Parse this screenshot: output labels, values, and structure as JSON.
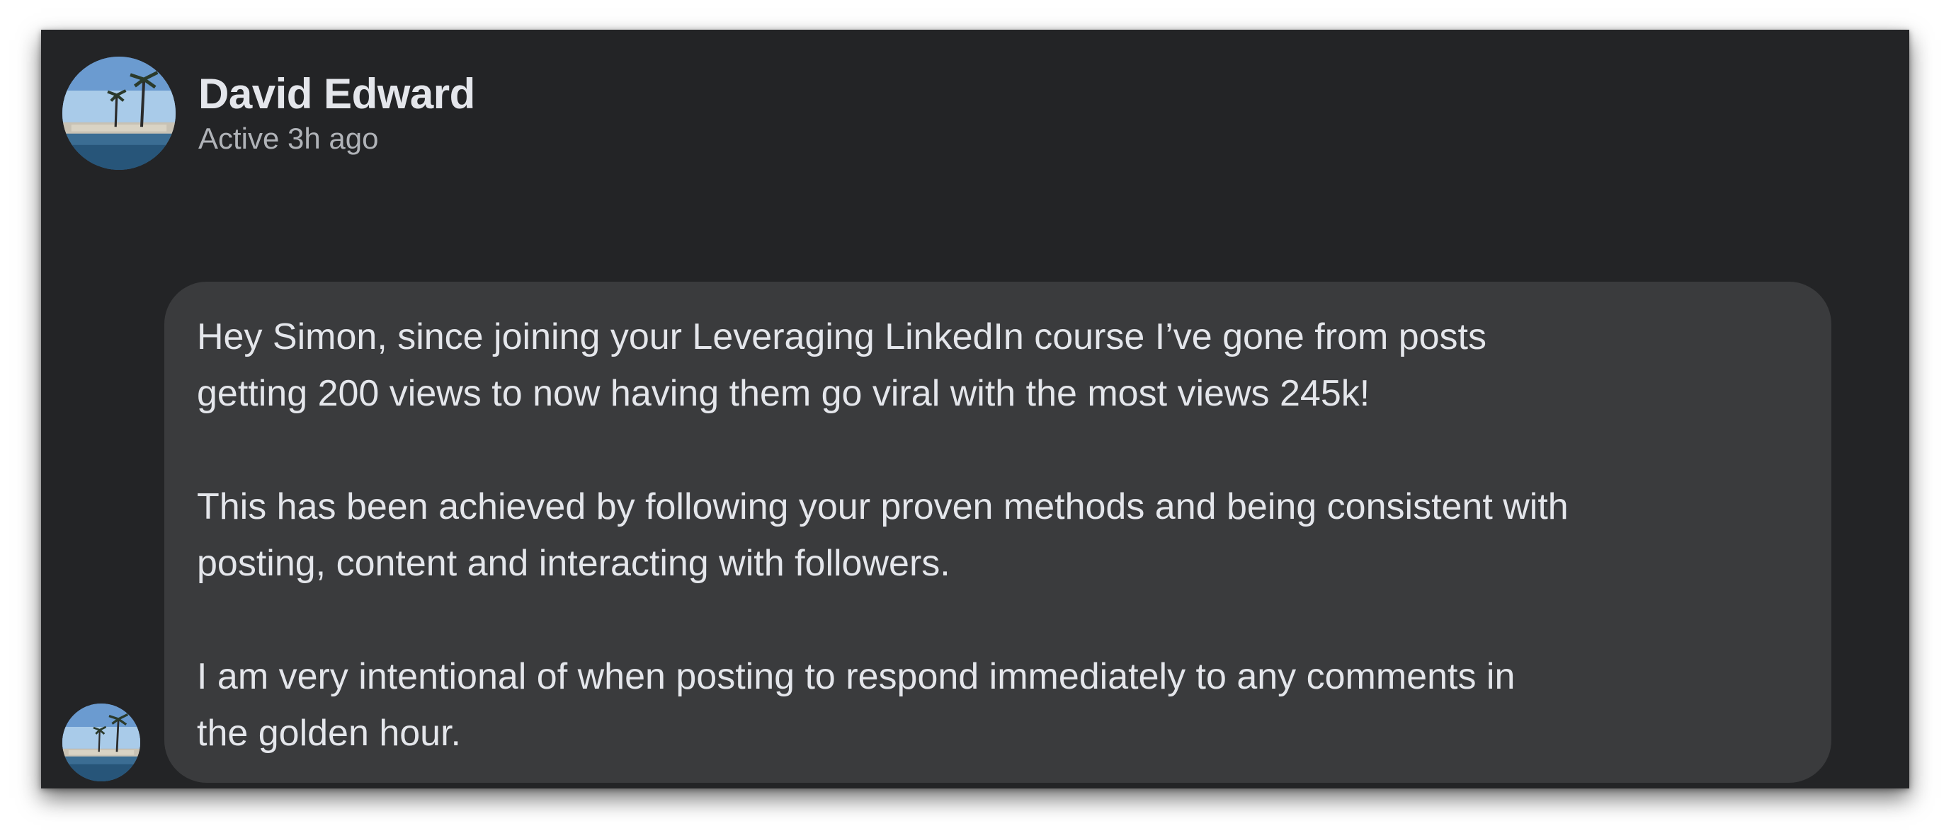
{
  "contact": {
    "name": "David Edward",
    "status": "Active 3h ago"
  },
  "message": {
    "paragraphs": [
      "Hey Simon, since joining your Leveraging LinkedIn course I’ve gone from posts\ngetting 200 views to now having them go viral with the most views 245k!",
      "This has been achieved by following your proven methods and being consistent with\nposting, content and interacting with followers.",
      "I am very intentional of when posting to respond immediately to any comments in\nthe golden hour."
    ]
  },
  "colors": {
    "background": "#232426",
    "bubble": "#3a3b3d",
    "primary_text": "#e4e6eb",
    "secondary_text": "#b0b3b8"
  }
}
